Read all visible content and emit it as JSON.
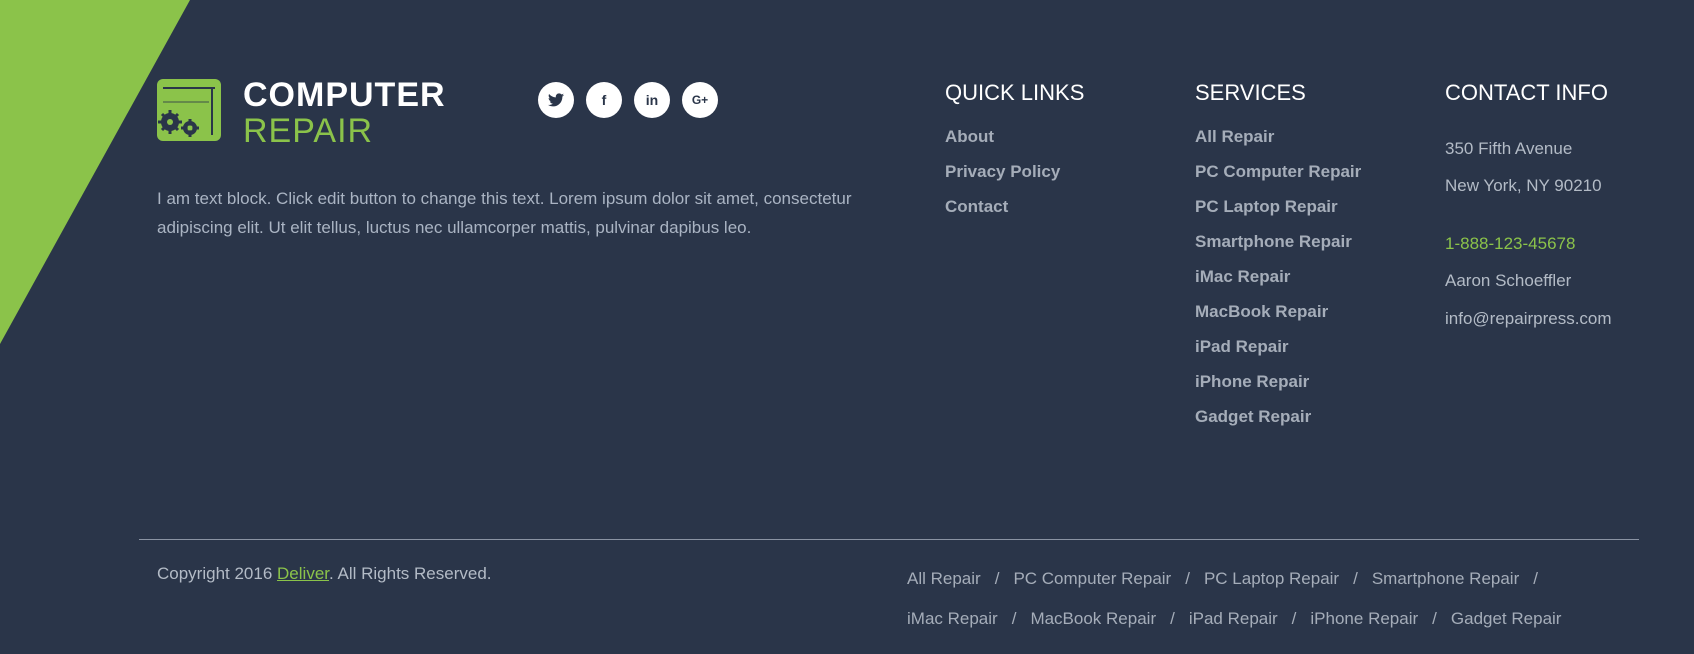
{
  "colors": {
    "background": "#2a3549",
    "accent": "#8bc34a",
    "heading": "#ffffff",
    "link": "#a5adb9",
    "text": "#b3bbc6"
  },
  "logo": {
    "line1": "COMPUTER",
    "line2": "REPAIR",
    "icon": "gears-monitor-icon"
  },
  "social": [
    {
      "name": "twitter",
      "icon": "twitter-icon"
    },
    {
      "name": "facebook",
      "icon": "facebook-icon",
      "glyph": "f"
    },
    {
      "name": "linkedin",
      "icon": "linkedin-icon",
      "glyph": "in"
    },
    {
      "name": "google-plus",
      "icon": "google-plus-icon",
      "glyph": "G+"
    }
  ],
  "about_text": "I am text block. Click edit button to change this text. Lorem ipsum dolor sit amet, consectetur adipiscing elit. Ut elit tellus, luctus nec ullamcorper mattis, pulvinar dapibus leo.",
  "quick_links": {
    "title": "QUICK LINKS",
    "items": [
      "About",
      "Privacy Policy",
      "Contact"
    ]
  },
  "services": {
    "title": "SERVICES",
    "items": [
      "All Repair",
      "PC Computer Repair",
      "PC Laptop Repair",
      "Smartphone Repair",
      "iMac Repair",
      "MacBook Repair",
      "iPad Repair",
      "iPhone Repair",
      "Gadget Repair"
    ]
  },
  "contact": {
    "title": "CONTACT INFO",
    "address1": "350 Fifth Avenue",
    "address2": "New York, NY 90210",
    "phone": "1-888-123-45678",
    "name": "Aaron Schoeffler",
    "email": "info@repairpress.com"
  },
  "footer": {
    "copyright_prefix": "Copyright 2016 ",
    "copyright_link": "Deliver",
    "copyright_suffix": ". All Rights Reserved.",
    "separator": "/",
    "nav_row1": [
      "All Repair",
      "PC Computer Repair",
      "PC Laptop Repair",
      "Smartphone Repair"
    ],
    "nav_row2": [
      "iMac Repair",
      "MacBook Repair",
      "iPad Repair",
      "iPhone Repair",
      "Gadget Repair"
    ]
  }
}
